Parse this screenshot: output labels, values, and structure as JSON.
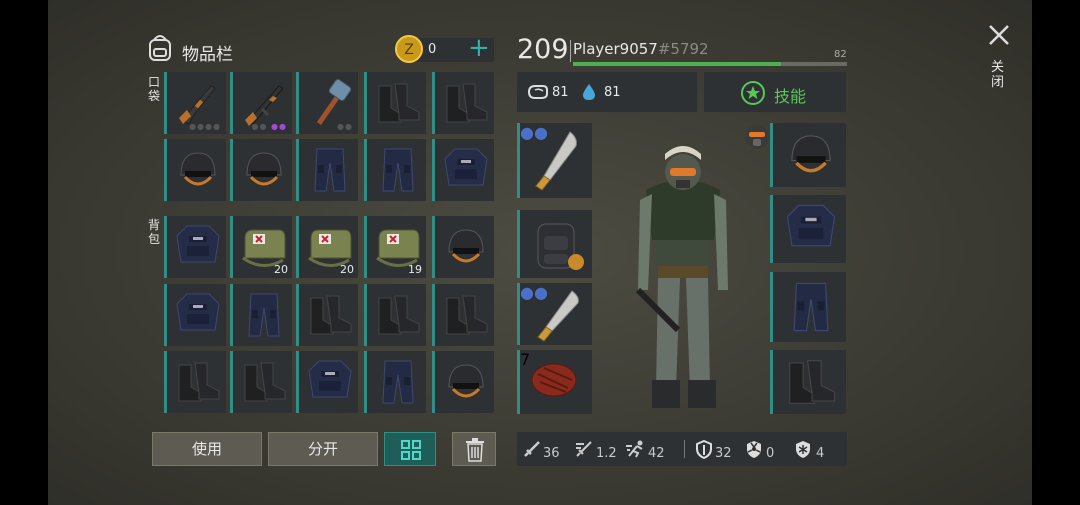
{
  "inventory": {
    "title": "物品栏",
    "pocket_label": "口袋",
    "backpack_label": "背包"
  },
  "currency": {
    "icon": "coin-icon",
    "value": "0",
    "add": "+"
  },
  "player": {
    "level": "209",
    "name": "Player9057",
    "id": "#5792",
    "xp_value": "82",
    "xp_fill_fraction": 0.76
  },
  "vitals": {
    "hunger": "81",
    "thirst": "81"
  },
  "skills_button": "技能",
  "close": {
    "label": "关闭"
  },
  "slots": {
    "p1": {
      "item": "rifle"
    },
    "p2": {
      "item": "assault-rifle"
    },
    "p3": {
      "item": "hammer"
    },
    "p4": {
      "item": "boots"
    },
    "p5": {
      "item": "boots"
    },
    "p6": {
      "item": "helmet"
    },
    "p7": {
      "item": "helmet"
    },
    "p8": {
      "item": "pants"
    },
    "p9": {
      "item": "pants"
    },
    "p10": {
      "item": "vest"
    },
    "b1": {
      "item": "vest"
    },
    "b2": {
      "item": "medkit-bag",
      "count": "20"
    },
    "b3": {
      "item": "medkit-bag",
      "count": "20"
    },
    "b4": {
      "item": "medkit-bag",
      "count": "19"
    },
    "b5": {
      "item": "helmet"
    },
    "b6": {
      "item": "vest"
    },
    "b7": {
      "item": "pants"
    },
    "b8": {
      "item": "boots"
    },
    "b9": {
      "item": "boots"
    },
    "b10": {
      "item": "boots"
    },
    "b11": {
      "item": "boots"
    },
    "b12": {
      "item": "boots"
    },
    "b13": {
      "item": "vest"
    },
    "b14": {
      "item": "pants"
    },
    "b15": {
      "item": "helmet"
    }
  },
  "equipment": {
    "weapon": "machete",
    "backpack": "backpack",
    "melee": "machete",
    "food_count": "7"
  },
  "buttons": {
    "use": "使用",
    "split": "分开"
  },
  "stats": {
    "damage": "36",
    "speed": "1.2",
    "move": "42",
    "defense": "32",
    "radiation": "0",
    "cold": "4"
  },
  "colors": {
    "accent": "#2f8f86",
    "xp_bar": "#4caf50",
    "skill_green": "#58c858"
  }
}
